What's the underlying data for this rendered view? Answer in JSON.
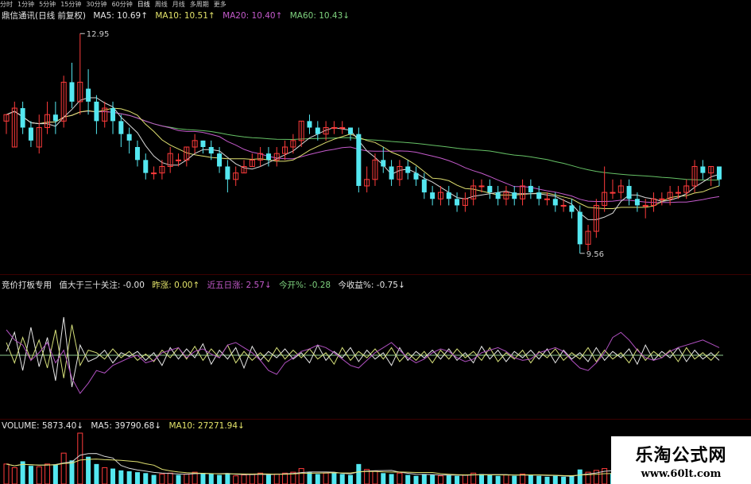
{
  "periods": [
    "分时",
    "1分钟",
    "5分钟",
    "15分钟",
    "30分钟",
    "60分钟",
    "日线",
    "周线",
    "月线",
    "多周期",
    "更多"
  ],
  "active_period": "日线",
  "price_header": {
    "stock": "鼎信通讯(日线 前复权)",
    "ma5": "MA5: 10.69↑",
    "ma10": "MA10: 10.51↑",
    "ma20": "MA20: 10.40↑",
    "ma60": "MA60: 10.43↓"
  },
  "high_label": "12.95",
  "low_label": "9.56",
  "indicator_header": {
    "name": "竞价打板专用",
    "v1": "值大于三十关注: -0.00",
    "v2": "昨涨: 0.00↑",
    "v3": "近五日涨: 2.57↓",
    "v4": "今开%: -0.28",
    "v5": "今收益%: -0.75↓"
  },
  "volume_header": {
    "vol": "VOLUME: 5873.40↓",
    "ma5": "MA5: 39790.68↓",
    "ma10": "MA10: 27271.94↓"
  },
  "watermark": {
    "title": "乐淘公式网",
    "url": "www.60lt.com"
  },
  "colors": {
    "up": "#ff3b3b",
    "down": "#54e7f0",
    "ma5": "#d8d8d8",
    "ma10": "#e0e070",
    "ma20": "#c45acb",
    "ma60": "#66c266"
  },
  "chart_data": {
    "type": "candlestick",
    "title": "鼎信通讯(日线 前复权)",
    "marked_high": 12.95,
    "marked_low": 9.56,
    "ylim": [
      9.3,
      13.1
    ],
    "candles": [
      [
        11.6,
        11.7,
        11.7,
        11.4
      ],
      [
        11.2,
        11.8,
        11.9,
        11.2
      ],
      [
        11.8,
        11.5,
        11.9,
        11.4
      ],
      [
        11.5,
        11.3,
        11.6,
        11.2
      ],
      [
        11.2,
        11.5,
        11.7,
        11.1
      ],
      [
        11.5,
        11.7,
        11.9,
        11.4
      ],
      [
        11.7,
        11.6,
        11.9,
        11.4
      ],
      [
        11.6,
        12.2,
        12.3,
        11.5
      ],
      [
        12.2,
        11.9,
        12.5,
        11.8
      ],
      [
        11.9,
        12.2,
        12.95,
        11.7
      ],
      [
        12.1,
        11.9,
        12.4,
        11.7
      ],
      [
        11.9,
        11.6,
        12.0,
        11.4
      ],
      [
        11.6,
        11.8,
        11.9,
        11.5
      ],
      [
        11.8,
        11.6,
        11.9,
        11.4
      ],
      [
        11.6,
        11.4,
        11.7,
        11.2
      ],
      [
        11.4,
        11.3,
        11.5,
        11.1
      ],
      [
        11.2,
        11.0,
        11.3,
        10.9
      ],
      [
        11.0,
        10.8,
        11.1,
        10.7
      ],
      [
        10.8,
        10.8,
        10.9,
        10.7
      ],
      [
        10.8,
        10.9,
        11.0,
        10.7
      ],
      [
        10.9,
        11.1,
        11.2,
        10.8
      ],
      [
        11.0,
        11.0,
        11.1,
        10.9
      ],
      [
        11.0,
        11.2,
        11.2,
        10.9
      ],
      [
        11.2,
        11.3,
        11.4,
        11.1
      ],
      [
        11.3,
        11.2,
        11.3,
        11.1
      ],
      [
        11.2,
        11.1,
        11.3,
        11.0
      ],
      [
        11.1,
        10.9,
        11.2,
        10.8
      ],
      [
        10.9,
        10.7,
        11.0,
        10.5
      ],
      [
        10.7,
        10.8,
        10.9,
        10.6
      ],
      [
        10.8,
        10.9,
        11.0,
        10.8
      ],
      [
        10.9,
        11.0,
        11.1,
        10.9
      ],
      [
        11.0,
        11.1,
        11.2,
        10.9
      ],
      [
        11.1,
        11.0,
        11.2,
        10.9
      ],
      [
        11.0,
        11.1,
        11.2,
        10.9
      ],
      [
        11.1,
        11.2,
        11.3,
        11.0
      ],
      [
        11.2,
        11.3,
        11.4,
        11.1
      ],
      [
        11.3,
        11.6,
        11.6,
        11.2
      ],
      [
        11.6,
        11.5,
        11.7,
        11.4
      ],
      [
        11.5,
        11.4,
        11.6,
        11.3
      ],
      [
        11.4,
        11.5,
        11.6,
        11.3
      ],
      [
        11.5,
        11.5,
        11.6,
        11.4
      ],
      [
        11.5,
        11.5,
        11.6,
        11.4
      ],
      [
        11.5,
        11.4,
        11.5,
        11.3
      ],
      [
        11.4,
        10.6,
        11.5,
        10.5
      ],
      [
        10.6,
        10.7,
        10.9,
        10.5
      ],
      [
        10.7,
        11.0,
        11.1,
        10.6
      ],
      [
        11.0,
        10.9,
        11.2,
        10.8
      ],
      [
        10.9,
        10.7,
        11.0,
        10.6
      ],
      [
        10.7,
        10.9,
        11.0,
        10.6
      ],
      [
        10.9,
        10.8,
        11.0,
        10.7
      ],
      [
        10.8,
        10.7,
        10.9,
        10.6
      ],
      [
        10.7,
        10.5,
        10.8,
        10.4
      ],
      [
        10.5,
        10.4,
        10.6,
        10.3
      ],
      [
        10.4,
        10.5,
        10.6,
        10.3
      ],
      [
        10.5,
        10.4,
        10.6,
        10.3
      ],
      [
        10.4,
        10.3,
        10.5,
        10.2
      ],
      [
        10.3,
        10.4,
        10.5,
        10.2
      ],
      [
        10.4,
        10.6,
        10.7,
        10.3
      ],
      [
        10.6,
        10.6,
        10.7,
        10.5
      ],
      [
        10.6,
        10.5,
        10.7,
        10.4
      ],
      [
        10.5,
        10.4,
        10.6,
        10.3
      ],
      [
        10.4,
        10.5,
        10.6,
        10.3
      ],
      [
        10.5,
        10.4,
        10.6,
        10.3
      ],
      [
        10.4,
        10.6,
        10.7,
        10.3
      ],
      [
        10.6,
        10.5,
        10.7,
        10.4
      ],
      [
        10.5,
        10.4,
        10.6,
        10.3
      ],
      [
        10.4,
        10.4,
        10.5,
        10.3
      ],
      [
        10.4,
        10.3,
        10.5,
        10.2
      ],
      [
        10.3,
        10.3,
        10.4,
        10.2
      ],
      [
        10.3,
        10.2,
        10.4,
        10.1
      ],
      [
        10.2,
        9.7,
        10.3,
        9.56
      ],
      [
        9.7,
        9.9,
        10.0,
        9.6
      ],
      [
        9.9,
        10.3,
        10.4,
        9.8
      ],
      [
        10.3,
        10.5,
        10.9,
        10.2
      ],
      [
        10.5,
        10.5,
        10.7,
        10.4
      ],
      [
        10.5,
        10.6,
        10.7,
        10.4
      ],
      [
        10.6,
        10.4,
        10.7,
        10.3
      ],
      [
        10.4,
        10.3,
        10.5,
        10.2
      ],
      [
        10.3,
        10.3,
        10.4,
        10.1
      ],
      [
        10.3,
        10.4,
        10.5,
        10.2
      ],
      [
        10.4,
        10.4,
        10.5,
        10.3
      ],
      [
        10.4,
        10.5,
        10.6,
        10.3
      ],
      [
        10.5,
        10.5,
        10.6,
        10.4
      ],
      [
        10.5,
        10.6,
        10.7,
        10.4
      ],
      [
        10.6,
        10.9,
        11.0,
        10.5
      ],
      [
        10.9,
        10.8,
        11.0,
        10.7
      ],
      [
        10.8,
        10.9,
        10.9,
        10.6
      ],
      [
        10.9,
        10.7,
        10.9,
        10.6
      ]
    ],
    "ma_series": [
      {
        "name": "MA5",
        "last": 10.69
      },
      {
        "name": "MA10",
        "last": 10.51
      },
      {
        "name": "MA20",
        "last": 10.4
      },
      {
        "name": "MA60",
        "last": 10.43
      }
    ],
    "indicator": {
      "name": "竞价打板专用",
      "lines": [
        {
          "values": [
            3,
            18,
            -12,
            22,
            -9,
            14,
            -20,
            30,
            -25,
            8,
            -5,
            -2,
            4,
            -6,
            2,
            -1,
            3,
            -4,
            2,
            -8,
            6,
            -3,
            5,
            -2,
            9,
            -7,
            4,
            -3,
            6,
            -10,
            7,
            -4,
            3,
            -2,
            5,
            -3,
            2,
            -6,
            8,
            -4,
            3,
            -2,
            6,
            -5,
            4,
            -3,
            2,
            -8,
            6,
            -4,
            3,
            -2,
            4,
            -3,
            5,
            -4,
            2,
            -6,
            7,
            -3,
            4,
            -5,
            3,
            -2,
            4,
            -3,
            5,
            -6,
            4,
            -3,
            2,
            -5,
            6,
            -4,
            3,
            -2,
            5,
            -7,
            8,
            -4,
            3,
            -2,
            6,
            -5,
            4,
            -3,
            2,
            -4
          ]
        },
        {
          "values": [
            10,
            -6,
            14,
            -4,
            12,
            -10,
            20,
            -18,
            24,
            -8,
            4,
            2,
            -3,
            5,
            -2,
            3,
            -4,
            1,
            -5,
            4,
            -2,
            6,
            -3,
            7,
            -4,
            5,
            -2,
            8,
            -6,
            3,
            -4,
            2,
            -5,
            6,
            -3,
            4,
            -2,
            5,
            -3,
            2,
            -7,
            6,
            -4,
            3,
            -2,
            5,
            -3,
            6,
            -5,
            2,
            -4,
            3,
            -6,
            4,
            -3,
            5,
            -2,
            3,
            -4,
            6,
            -5,
            2,
            -3,
            4,
            -6,
            3,
            -2,
            5,
            -4,
            2,
            -3,
            6,
            -5,
            4,
            -3,
            2,
            -6,
            5,
            -4,
            3,
            -2,
            4,
            -5,
            6,
            -3,
            2,
            -4,
            3
          ]
        },
        {
          "values": [
            20,
            12,
            8,
            -4,
            2,
            10,
            -6,
            4,
            -18,
            -30,
            -22,
            -12,
            -14,
            -8,
            -5,
            -2,
            0,
            -6,
            -4,
            2,
            4,
            6,
            -2,
            3,
            5,
            1,
            -2,
            8,
            10,
            6,
            2,
            -4,
            -12,
            -15,
            -6,
            -2,
            3,
            5,
            8,
            6,
            2,
            -3,
            -8,
            -10,
            -4,
            2,
            6,
            10,
            4,
            -2,
            -6,
            -3,
            2,
            5,
            3,
            -2,
            -5,
            -3,
            2,
            4,
            6,
            3,
            -2,
            -4,
            -3,
            2,
            4,
            6,
            3,
            -4,
            -10,
            -12,
            -6,
            2,
            14,
            18,
            12,
            4,
            -2,
            -4,
            -2,
            3,
            6,
            8,
            10,
            12,
            9,
            6
          ]
        }
      ]
    },
    "volume": {
      "values": [
        22,
        18,
        25,
        20,
        19,
        22,
        21,
        34,
        26,
        56,
        30,
        22,
        18,
        17,
        15,
        14,
        13,
        12,
        10,
        11,
        12,
        10,
        11,
        13,
        12,
        11,
        10,
        12,
        9,
        10,
        11,
        12,
        10,
        11,
        12,
        13,
        17,
        13,
        11,
        12,
        12,
        11,
        10,
        22,
        16,
        14,
        12,
        11,
        12,
        10,
        9,
        11,
        10,
        9,
        10,
        9,
        10,
        12,
        11,
        10,
        9,
        10,
        9,
        11,
        10,
        9,
        8,
        9,
        8,
        9,
        16,
        13,
        15,
        17,
        12,
        11,
        10,
        9,
        8,
        9,
        9,
        10,
        9,
        10,
        13,
        12,
        11,
        10
      ],
      "up": [
        true,
        true,
        false,
        false,
        true,
        true,
        false,
        true,
        false,
        true,
        false,
        false,
        true,
        false,
        false,
        false,
        false,
        false,
        false,
        true,
        true,
        false,
        true,
        true,
        false,
        false,
        false,
        false,
        true,
        true,
        true,
        true,
        false,
        true,
        true,
        true,
        true,
        false,
        false,
        true,
        false,
        false,
        false,
        false,
        true,
        true,
        false,
        false,
        true,
        false,
        false,
        false,
        false,
        true,
        false,
        false,
        true,
        true,
        false,
        false,
        false,
        true,
        false,
        true,
        false,
        false,
        false,
        false,
        false,
        false,
        false,
        true,
        true,
        true,
        false,
        true,
        false,
        false,
        false,
        true,
        false,
        true,
        false,
        true,
        true,
        false,
        true,
        false
      ]
    }
  }
}
